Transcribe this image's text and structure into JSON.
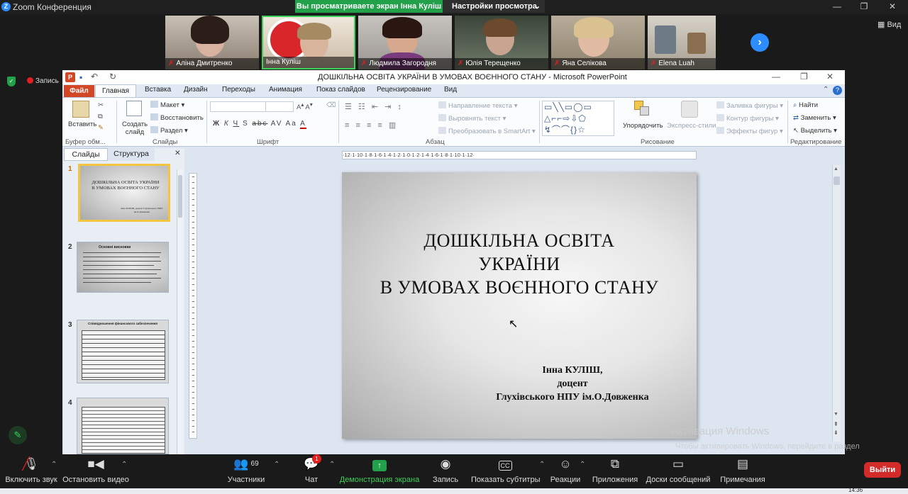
{
  "zoom": {
    "window_title": "Zoom Конференция",
    "share_banner": "Вы просматриваете экран Інна Куліш",
    "view_options": "Настройки просмотра",
    "view_button": "Вид",
    "recording_label": "Запись",
    "participants": [
      {
        "name": "Аліна Дмитренко",
        "muted": true
      },
      {
        "name": "Інна Куліш",
        "muted": false
      },
      {
        "name": "Людмила Загородня",
        "muted": true
      },
      {
        "name": "Юлія Терещенко",
        "muted": true
      },
      {
        "name": "Яна Селікова",
        "muted": true
      },
      {
        "name": "Elena Luah",
        "muted": true
      }
    ],
    "toolbar": {
      "unmute": "Включить звук",
      "start_video": "Остановить видео",
      "participants": "Участники",
      "participants_count": "69",
      "chat": "Чат",
      "chat_badge": "1",
      "share_screen": "Демонстрация экрана",
      "record": "Запись",
      "captions": "Показать субтитры",
      "reactions": "Реакции",
      "apps": "Приложения",
      "whiteboards": "Доски сообщений",
      "notes": "Примечания",
      "leave": "Выйти"
    },
    "clock": "14:36"
  },
  "ppt": {
    "title": "ДОШКІЛЬНА ОСВІТА УКРАЇНИ В УМОВАХ ВОЄННОГО СТАНУ  -  Microsoft PowerPoint",
    "tabs": [
      "Файл",
      "Главная",
      "Вставка",
      "Дизайн",
      "Переходы",
      "Анимация",
      "Показ слайдов",
      "Рецензирование",
      "Вид"
    ],
    "ribbon": {
      "paste": "Вставить",
      "new_slide": "Создать слайд",
      "layout": "Макет",
      "reset": "Восстановить",
      "section": "Раздел",
      "clipboard_group": "Буфер обм...",
      "slides_group": "Слайды",
      "font_group": "Шрифт",
      "paragraph_group": "Абзац",
      "drawing_group": "Рисование",
      "editing_group": "Редактирование",
      "text_direction": "Направление текста",
      "align_text": "Выровнять текст",
      "smartart": "Преобразовать в SmartArt",
      "arrange": "Упорядочить",
      "quick_styles": "Экспресс-стили",
      "shape_fill": "Заливка фигуры",
      "shape_outline": "Контур фигуры",
      "shape_effects": "Эффекты фигур",
      "find": "Найти",
      "replace": "Заменить",
      "select": "Выделить",
      "font_buttons": [
        "Ж",
        "К",
        "Ч",
        "S",
        "abc",
        "AV",
        "Aa",
        "A"
      ]
    },
    "pane_tabs": [
      "Слайды",
      "Структура"
    ],
    "slide_numbers": [
      "1",
      "2",
      "3",
      "4"
    ],
    "thumb1": {
      "title": "ДОШКІЛЬНА ОСВІТА УКРАЇНИ В УМОВАХ ВОЄННОГО СТАНУ",
      "author": "Інна КУЛІШ, доцент Глухівського НПУ ім.О.Довженка"
    },
    "thumb2_title": "Основні висновки",
    "thumb3_title": "Співвідношення фінансового забезпечення",
    "slide": {
      "title_lines": [
        "ДОШКІЛЬНА ОСВІТА",
        "УКРАЇНИ",
        "В УМОВАХ ВОЄННОГО СТАНУ"
      ],
      "author_lines": [
        "Інна КУЛІШ,",
        "доцент",
        "Глухівського НПУ ім.О.Довженка"
      ]
    },
    "ruler": "·12·1·10·1·8·1·6·1·4·1·2·1·0·1·2·1·4·1·6·1·8·1·10·1·12·"
  },
  "watermark": {
    "title": "Активация Windows",
    "text": "Чтобы активировать Windows, перейдите в раздел \"Параметры\"."
  }
}
